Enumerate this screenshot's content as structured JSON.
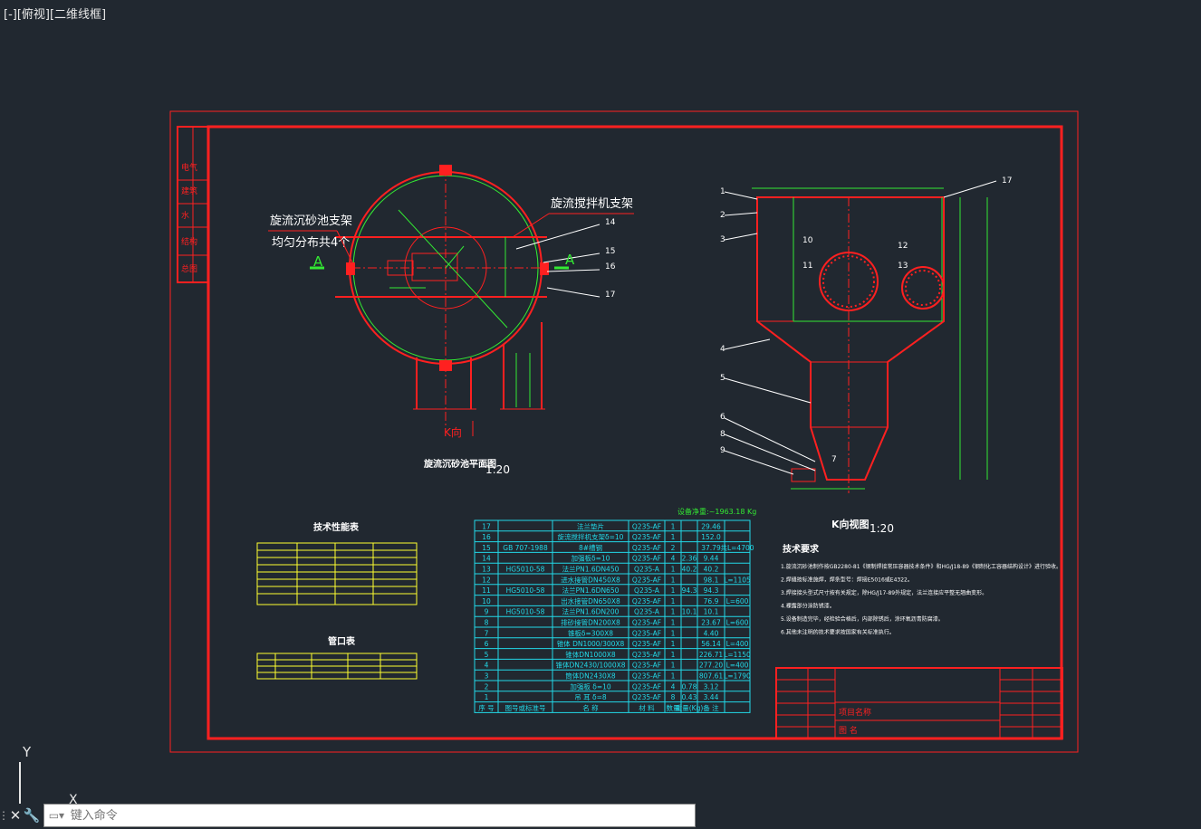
{
  "viewport": {
    "label": "[-][俯视][二维线框]"
  },
  "drawing": {
    "plan_title": "旋流沉砂池平面图",
    "plan_scale": "1:20",
    "k_title": "K向视图",
    "k_scale": "1:20",
    "label_support": "旋流沉砂池支架",
    "label_support2": "均匀分布共4个",
    "label_mixer": "旋流搅拌机支架",
    "label_A": "A",
    "label_K": "K向",
    "weight_note": "设备净重:~1963.18 Kg",
    "tech_perf_title": "技术性能表",
    "nozzle_title": "管口表",
    "tech_req_title": "技术要求",
    "tech_req": [
      "1.旋流沉砂池制作按GB2280-81《钢制焊接常压容器技术条件》和HG/J18-89《钢制化工容器结构设计》进行验收。",
      "2.焊缝按标准施焊，焊条型号：焊接E5016或E4322。",
      "3.焊接接头型式尺寸按有关规定，除HG/J17-89外规定，法兰连接应平整无翘曲变形。",
      "4.裸露部分涂防锈漆。",
      "5.设备制造完毕，经检验合格后，内部除锈后，涂环氧沥青防腐漆。",
      "6.其他未注明的技术要求按国家有关标准执行。"
    ],
    "bom_rows": [
      [
        "17",
        "",
        "法兰垫片",
        "Q235-AF",
        "1",
        "",
        "29.46",
        ""
      ],
      [
        "16",
        "",
        "旋流搅拌机支架δ=10",
        "Q235-AF",
        "1",
        "",
        "152.0",
        ""
      ],
      [
        "15",
        "GB 707-1988",
        "8#槽钢",
        "Q235-AF",
        "2",
        "",
        "37.79",
        "共L=4700"
      ],
      [
        "14",
        "",
        "加强板δ=10",
        "Q235-AF",
        "4",
        "2.36",
        "9.44",
        ""
      ],
      [
        "13",
        "HG5010-58",
        "法兰PN1.6DN450",
        "Q235-A",
        "1",
        "40.2",
        "40.2",
        ""
      ],
      [
        "12",
        "",
        "进水接管DN450X8",
        "Q235-AF",
        "1",
        "",
        "98.1",
        "L=1105"
      ],
      [
        "11",
        "HG5010-58",
        "法兰PN1.6DN650",
        "Q235-A",
        "1",
        "94.3",
        "94.3",
        ""
      ],
      [
        "10",
        "",
        "出水接管DN650X8",
        "Q235-AF",
        "1",
        "",
        "76.9",
        "L=600"
      ],
      [
        "9",
        "HG5010-58",
        "法兰PN1.6DN200",
        "Q235-A",
        "1",
        "10.1",
        "10.1",
        ""
      ],
      [
        "8",
        "",
        "排砂接管DN200X8",
        "Q235-AF",
        "1",
        "",
        "23.67",
        "L=600"
      ],
      [
        "7",
        "",
        "锥板δ=300X8",
        "Q235-AF",
        "1",
        "",
        "4.40",
        ""
      ],
      [
        "6",
        "",
        "锥体 DN1000/300X8",
        "Q235-AF",
        "1",
        "",
        "56.14",
        "L=400"
      ],
      [
        "5",
        "",
        "锥体DN1000X8",
        "Q235-AF",
        "1",
        "",
        "226.71",
        "L=1150"
      ],
      [
        "4",
        "",
        "锥体DN2430/1000X8",
        "Q235-AF",
        "1",
        "",
        "277.20",
        "L=400"
      ],
      [
        "3",
        "",
        "筒体DN2430X8",
        "Q235-AF",
        "1",
        "",
        "807.61",
        "L=1790"
      ],
      [
        "2",
        "",
        "加强板 δ=10",
        "Q235-AF",
        "4",
        "0.78",
        "3.12",
        ""
      ],
      [
        "1",
        "",
        "吊 耳 δ=8",
        "Q235-AF",
        "8",
        "0.43",
        "3.44",
        ""
      ]
    ],
    "bom_header": [
      "序 号",
      "图号或标准号",
      "名 称",
      "材 料",
      "数量",
      "重量(Kg)",
      "备 注"
    ],
    "title_block": {
      "project": "项目名称",
      "drawing": "图 名"
    },
    "side_labels": [
      "电气",
      "建筑",
      "水",
      "结构",
      "总图"
    ]
  },
  "command_bar": {
    "placeholder": "键入命令"
  },
  "ucs": {
    "y": "Y",
    "x": "X"
  },
  "colors": {
    "background": "#212830",
    "frame": "#ff2020",
    "green": "#33e833",
    "cyan": "#22d9e8",
    "yellow": "#ffff30",
    "white": "#ffffff"
  }
}
